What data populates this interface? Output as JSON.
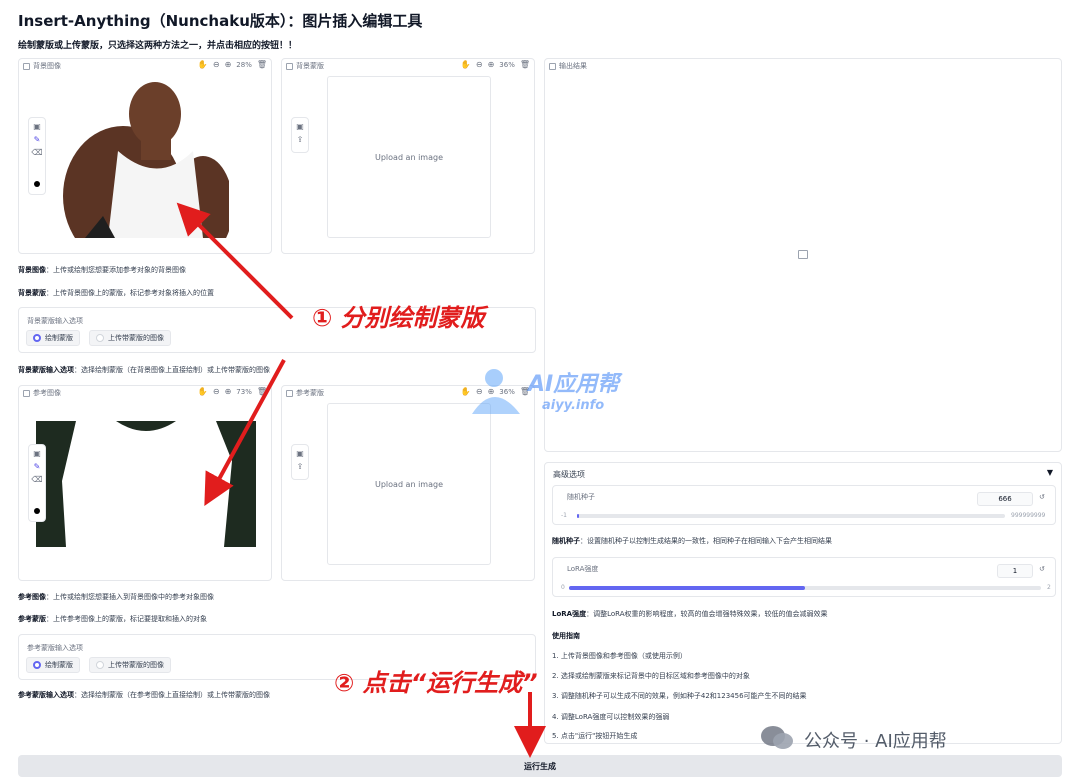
{
  "app": {
    "title": "Insert-Anything（Nunchaku版本）：图片插入编辑工具",
    "subtitle": "绘制蒙版或上传蒙版，只选择这两种方法之一，并点击相应的按钮！！"
  },
  "bg_section": {
    "image_panel": {
      "label": "背景图像",
      "zoom": "28%"
    },
    "mask_panel": {
      "label": "背景蒙版",
      "zoom": "36%",
      "upload_text": "Upload an image"
    },
    "desc_image_bold": "背景图像",
    "desc_image": "：上传或绘制您想要添加参考对象的背景图像",
    "desc_mask_bold": "背景蒙版",
    "desc_mask": "：上传背景图像上的蒙版，标记参考对象将插入的位置",
    "options": {
      "title": "背景蒙版输入选项",
      "opt1": "绘制蒙版",
      "opt2": "上传带蒙版的图像"
    },
    "options_desc_bold": "背景蒙版输入选项",
    "options_desc": "：选择绘制蒙版（在背景图像上直接绘制）或上传带蒙版的图像"
  },
  "ref_section": {
    "image_panel": {
      "label": "参考图像",
      "zoom": "73%"
    },
    "mask_panel": {
      "label": "参考蒙版",
      "zoom": "36%",
      "upload_text": "Upload an image"
    },
    "desc_image_bold": "参考图像",
    "desc_image": "：上传或绘制您想要插入到背景图像中的参考对象图像",
    "desc_mask_bold": "参考蒙版",
    "desc_mask": "：上传参考图像上的蒙版，标记要提取和插入的对象",
    "options": {
      "title": "参考蒙版输入选项",
      "opt1": "绘制蒙版",
      "opt2": "上传带蒙版的图像"
    },
    "options_desc_bold": "参考蒙版输入选项",
    "options_desc": "：选择绘制蒙版（在参考图像上直接绘制）或上传带蒙版的图像"
  },
  "output": {
    "label": "输出结果"
  },
  "advanced": {
    "title": "高级选项",
    "seed": {
      "label": "随机种子",
      "value": "666",
      "min": "-1",
      "max": "999999999",
      "fraction": 0.0
    },
    "seed_desc_bold": "随机种子",
    "seed_desc": "：设置随机种子以控制生成结果的一致性，相同种子在相同输入下会产生相同结果",
    "lora": {
      "label": "LoRA强度",
      "value": "1",
      "min": "0",
      "max": "2",
      "fraction": 0.5
    },
    "lora_desc_bold": "LoRA强度",
    "lora_desc": "：调整LoRA权重的影响程度，较高的值会增强特殊效果，较低的值会减弱效果",
    "guide_title": "使用指南",
    "guide": [
      "1. 上传背景图像和参考图像（或使用示例）",
      "2. 选择或绘制蒙版来标记背景中的目标区域和参考图像中的对象",
      "3. 调整随机种子可以生成不同的效果，例如种子42和123456可能产生不同的结果",
      "4. 调整LoRA强度可以控制效果的强弱",
      "5. 点击\"运行\"按钮开始生成"
    ]
  },
  "run_button": "运行生成",
  "annotations": {
    "step1": "① 分别绘制蒙版",
    "step2": "② 点击“运行生成”"
  },
  "watermark": {
    "name": "AI应用帮",
    "domain": "aiyy.info"
  },
  "footer": "公众号 · AI应用帮",
  "colors": {
    "accent": "#6366f1",
    "arrow": "#e11d1d"
  }
}
